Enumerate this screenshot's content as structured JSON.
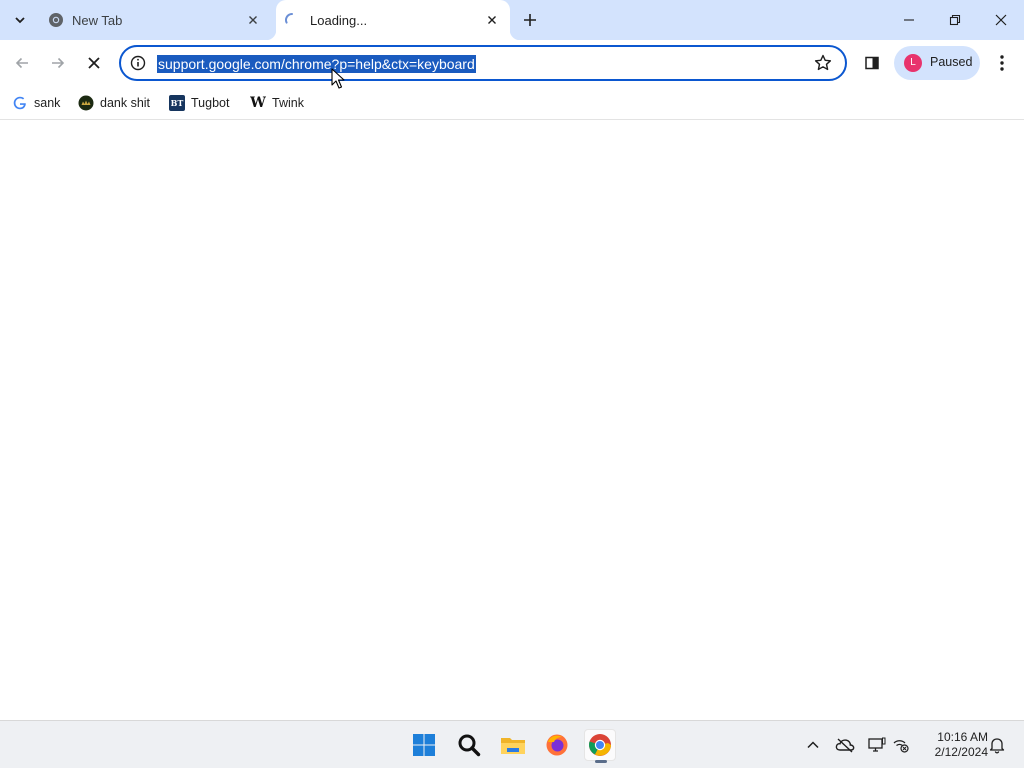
{
  "browser": {
    "tabs": [
      {
        "title": "New Tab",
        "favicon": "chrome-icon",
        "active": false
      },
      {
        "title": "Loading...",
        "favicon": "loading-spinner-icon",
        "active": true
      }
    ],
    "address_bar": {
      "url": "support.google.com/chrome?p=help&ctx=keyboard",
      "selected": true
    },
    "profile": {
      "initial": "L",
      "status": "Paused",
      "avatar_color": "#e8336d"
    },
    "bookmarks": [
      {
        "label": "sank",
        "icon": "google-g-icon"
      },
      {
        "label": "dank shit",
        "icon": "dank-shit-favicon"
      },
      {
        "label": "Tugbot",
        "icon": "bt-favicon",
        "icon_text": "BT"
      },
      {
        "label": "Twink",
        "icon": "w-favicon",
        "icon_text": "W"
      }
    ],
    "accent_color": "#0b57d0",
    "tabstrip_color": "#d3e3fd"
  },
  "taskbar": {
    "apps": [
      "windows-start-icon",
      "search-icon",
      "file-explorer-icon",
      "firefox-icon",
      "chrome-icon"
    ],
    "tray_icons": [
      "chevron-up-icon",
      "onedrive-icon",
      "display-icon",
      "network-icon"
    ],
    "time": "10:16 AM",
    "date": "2/12/2024"
  }
}
